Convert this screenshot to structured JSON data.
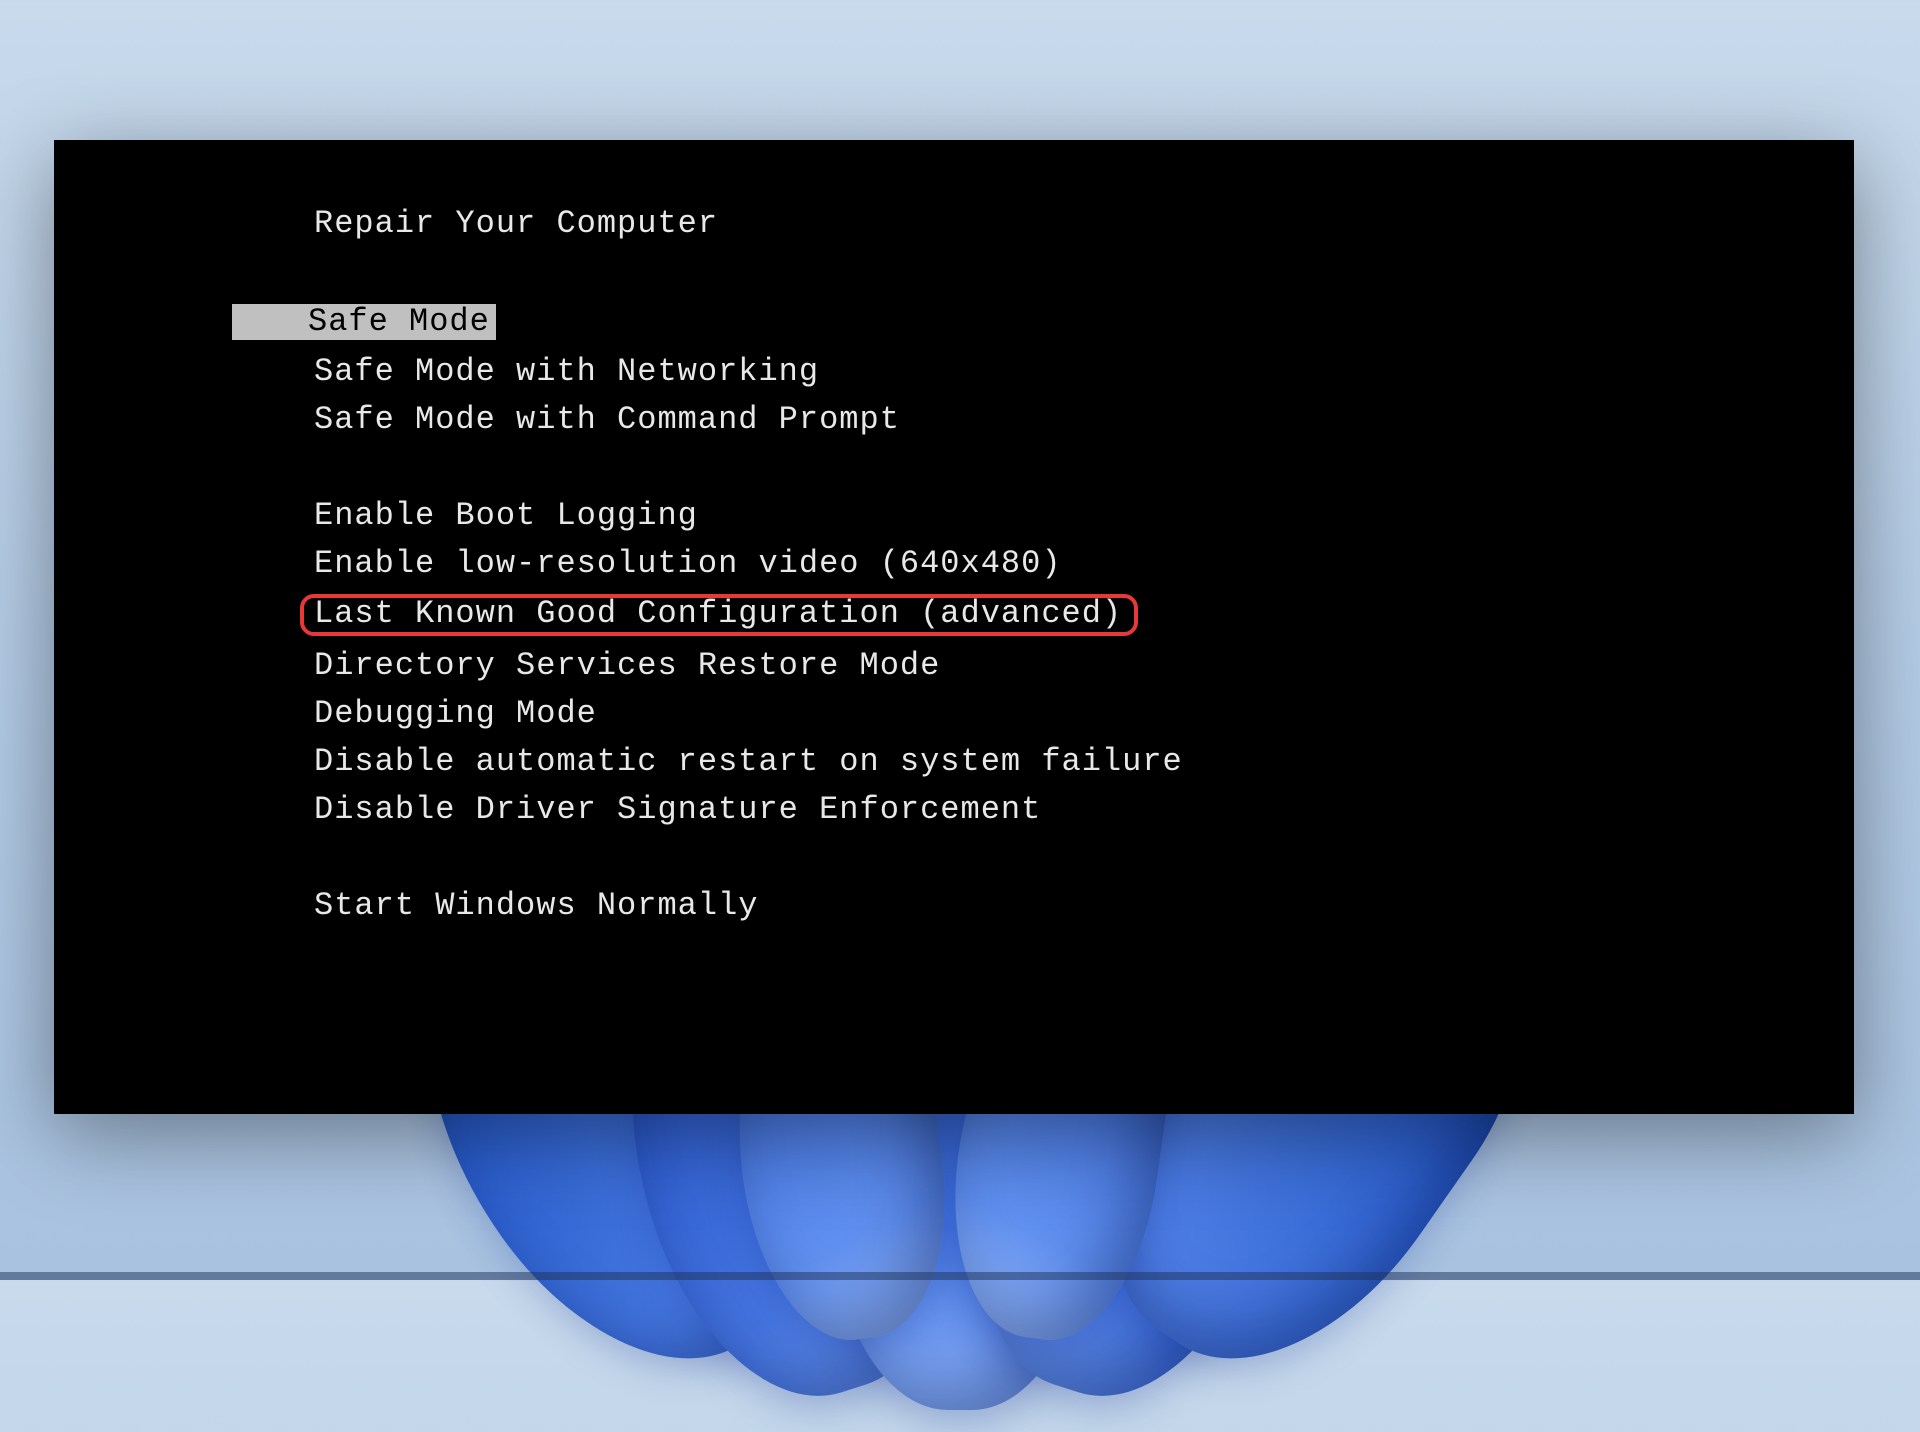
{
  "boot_menu": {
    "header": "Repair Your Computer",
    "group_safe": {
      "selected": "Safe Mode",
      "networking": "Safe Mode with Networking",
      "command_prompt": "Safe Mode with Command Prompt"
    },
    "group_advanced": {
      "boot_logging": "Enable Boot Logging",
      "low_res": "Enable low-resolution video (640x480)",
      "lkgc": "Last Known Good Configuration (advanced)",
      "dsrm": "Directory Services Restore Mode",
      "debugging": "Debugging Mode",
      "disable_restart": "Disable automatic restart on system failure",
      "disable_driver_sig": "Disable Driver Signature Enforcement"
    },
    "group_normal": {
      "start_normal": "Start Windows Normally"
    }
  },
  "annotation": {
    "highlight_color": "#e83838",
    "selected_bg": "#c0c0c0"
  }
}
